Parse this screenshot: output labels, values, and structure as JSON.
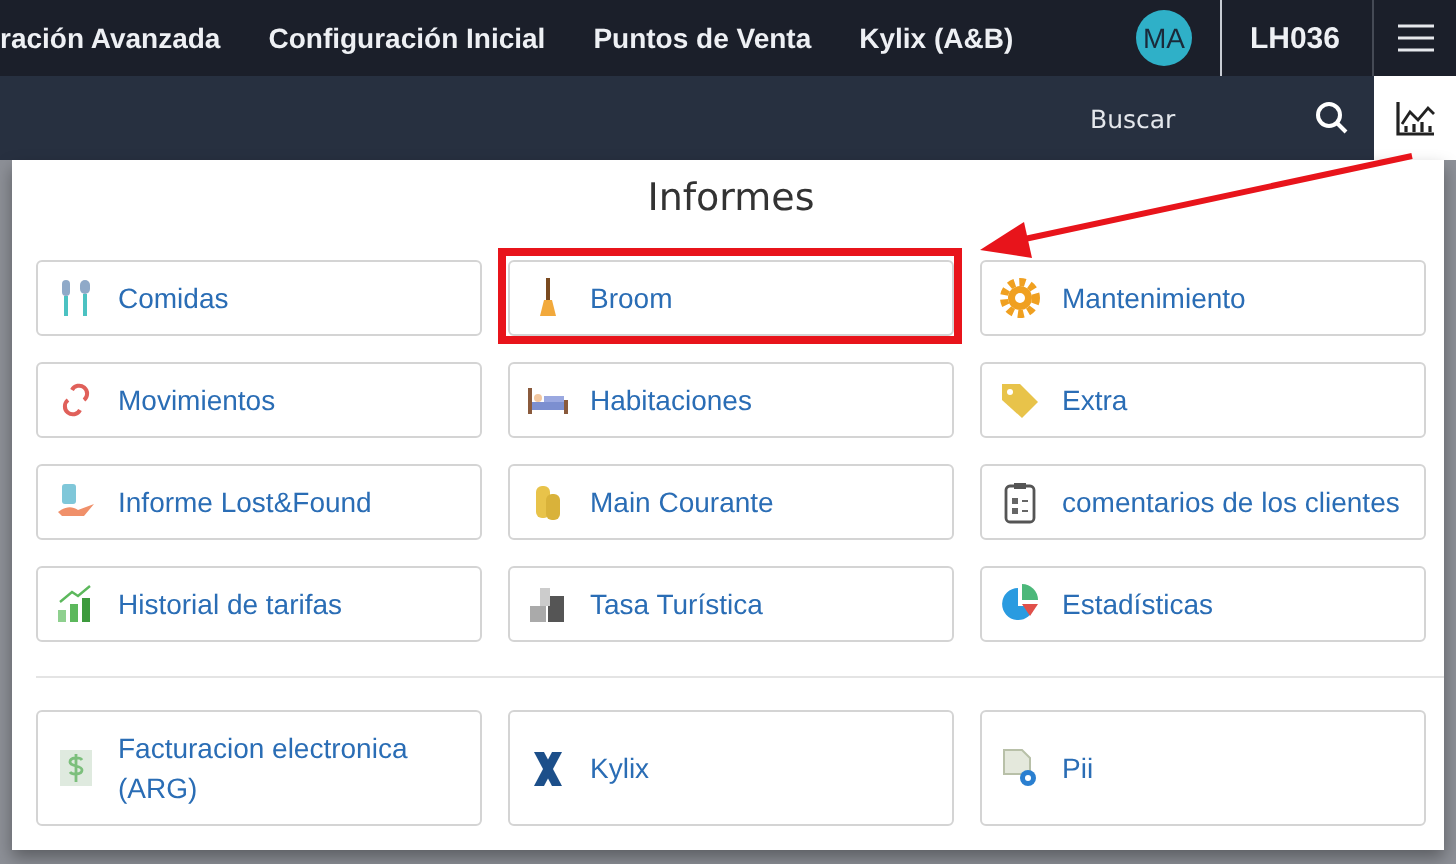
{
  "navbar": {
    "menu_items": [
      "ración Avanzada",
      "Configuración Inicial",
      "Puntos de Venta",
      "Kylix (A&B)"
    ],
    "avatar": "MA",
    "property_code": "LH036"
  },
  "toolbar": {
    "search": {
      "placeholder": "Buscar"
    }
  },
  "panel": {
    "title": "Informes",
    "groups": [
      {
        "items": [
          {
            "label": "Comidas",
            "highlighted": false
          },
          {
            "label": "Broom",
            "highlighted": true
          },
          {
            "label": "Mantenimiento",
            "highlighted": false
          },
          {
            "label": "Movimientos",
            "highlighted": false
          },
          {
            "label": "Habitaciones",
            "highlighted": false
          },
          {
            "label": "Extra",
            "highlighted": false
          },
          {
            "label": "Informe Lost&Found",
            "highlighted": false
          },
          {
            "label": "Main Courante",
            "highlighted": false
          },
          {
            "label": "comentarios de los clientes",
            "highlighted": false
          },
          {
            "label": "Historial de tarifas",
            "highlighted": false
          },
          {
            "label": "Tasa Turística",
            "highlighted": false
          },
          {
            "label": "Estadísticas",
            "highlighted": false
          }
        ]
      },
      {
        "items": [
          {
            "label": "Facturacion electronica (ARG)",
            "highlighted": false
          },
          {
            "label": "Kylix",
            "highlighted": false
          },
          {
            "label": "Pii",
            "highlighted": false
          }
        ]
      }
    ]
  }
}
